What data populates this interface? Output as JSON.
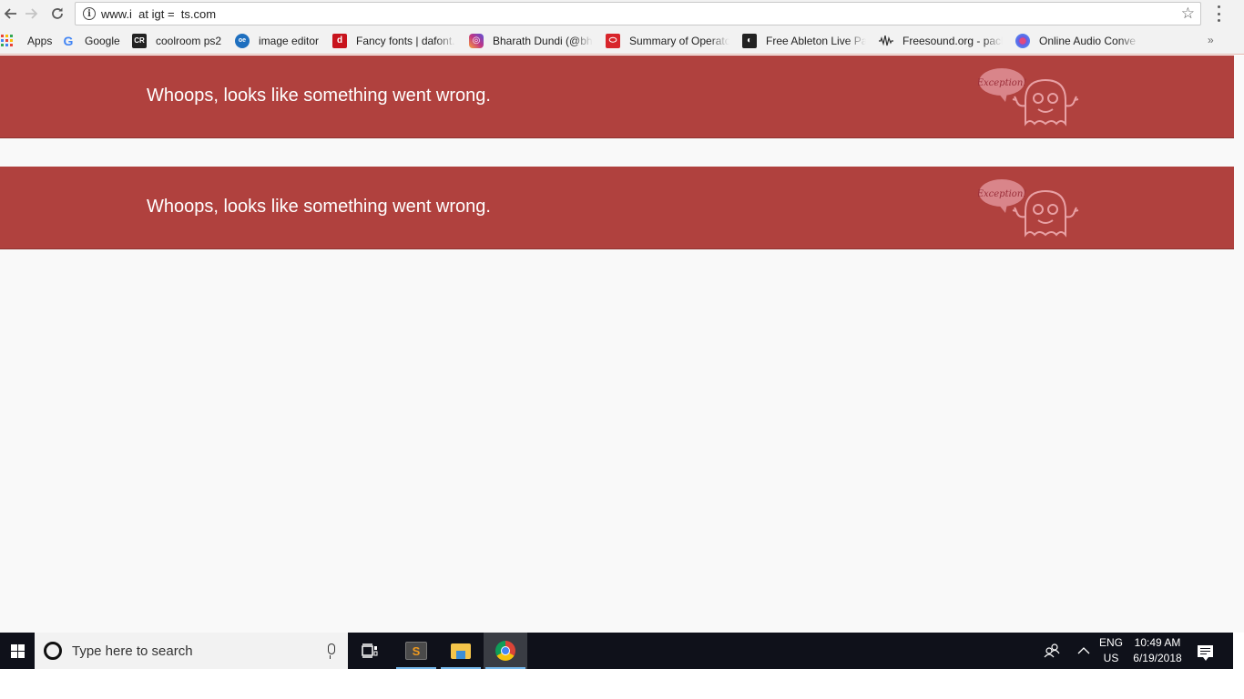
{
  "browser": {
    "url": "www.i  at igt =  ts.com",
    "back_icon": "arrow-left",
    "forward_icon": "arrow-right",
    "reload_icon": "reload",
    "info_icon": "info",
    "bookmark_star_icon": "star",
    "menu_icon": "vertical-dots"
  },
  "bookmarks": [
    {
      "label": "Apps",
      "icon": "apps-grid"
    },
    {
      "label": "Google",
      "icon": "google-g",
      "color": "#4285f4"
    },
    {
      "label": "coolroom ps2",
      "icon": "cr-logo",
      "color": "#222222"
    },
    {
      "label": "image editor",
      "icon": "globe",
      "color": "#1e6fbf"
    },
    {
      "label": "Fancy fonts | dafont.",
      "icon": "dafont",
      "color": "#c8141d"
    },
    {
      "label": "Bharath Dundi (@bh",
      "icon": "instagram",
      "color": "#c13584"
    },
    {
      "label": "Summary of Operato",
      "icon": "oracle",
      "color": "#d8252b"
    },
    {
      "label": "Free Ableton Live Pa",
      "icon": "ableton",
      "color": "#222222"
    },
    {
      "label": "Freesound.org - pacl",
      "icon": "waveform",
      "color": "#333333"
    },
    {
      "label": "Online Audio Conve",
      "icon": "audio-converter",
      "color": "#6b5ae0"
    }
  ],
  "bookmarks_overflow_icon": "double-chevron-right",
  "page": {
    "background": "#f9f9f9",
    "banner_color": "#b0413e",
    "errors": [
      {
        "message": "Whoops, looks like something went wrong.",
        "badge_text": "Exception!"
      },
      {
        "message": "Whoops, looks like something went wrong.",
        "badge_text": "Exception!"
      }
    ]
  },
  "taskbar": {
    "search_placeholder": "Type here to search",
    "apps": [
      {
        "name": "Task View",
        "icon": "task-view"
      },
      {
        "name": "Sublime Text",
        "icon": "sublime-text",
        "glyph": "S",
        "running": true
      },
      {
        "name": "File Explorer",
        "icon": "file-explorer",
        "running": true
      },
      {
        "name": "Google Chrome",
        "icon": "chrome",
        "running": true,
        "active": true
      }
    ],
    "tray": {
      "language_top": "ENG",
      "language_bottom": "US",
      "time": "10:49 AM",
      "date": "6/19/2018"
    }
  }
}
